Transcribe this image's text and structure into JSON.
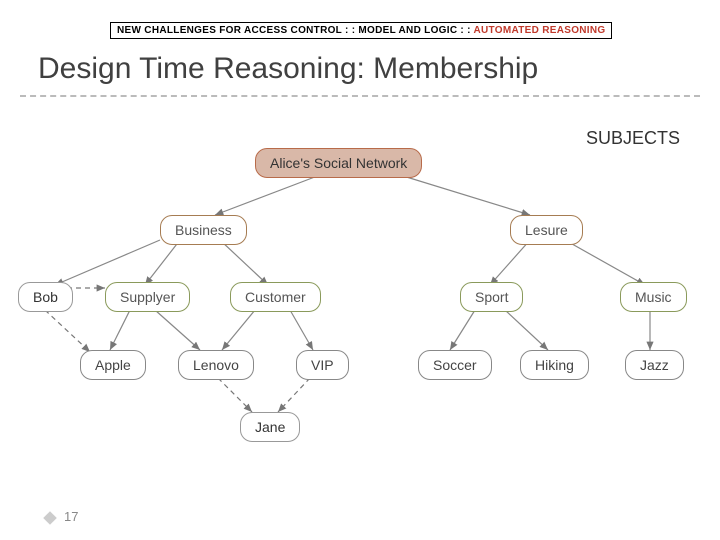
{
  "breadcrumb": {
    "part1": "NEW CHALLENGES FOR ACCESS CONTROL : : MODEL AND LOGIC : : ",
    "part2": "AUTOMATED REASONING"
  },
  "title": "Design Time Reasoning: Membership",
  "subjects_label": "SUBJECTS",
  "nodes": {
    "root": "Alice's Social Network",
    "business": "Business",
    "leisure": "Lesure",
    "bob": "Bob",
    "supplier": "Supplyer",
    "customer": "Customer",
    "sport": "Sport",
    "music": "Music",
    "apple": "Apple",
    "lenovo": "Lenovo",
    "vip": "VIP",
    "soccer": "Soccer",
    "hiking": "Hiking",
    "jazz": "Jazz",
    "jane": "Jane"
  },
  "page_number": "17"
}
